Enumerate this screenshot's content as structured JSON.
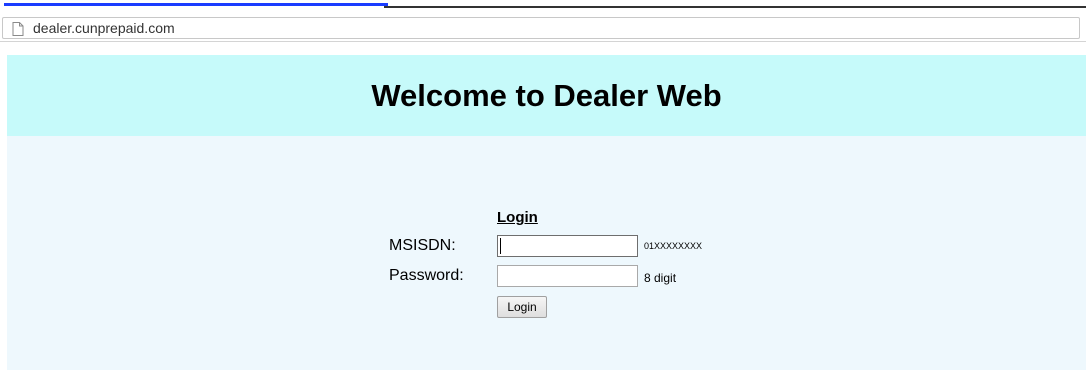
{
  "browser": {
    "url": "dealer.cunprepaid.com",
    "page_icon": "page-icon"
  },
  "header": {
    "title": "Welcome to Dealer Web"
  },
  "login_form": {
    "heading": "Login",
    "msisdn_label": "MSISDN:",
    "msisdn_value": "",
    "msisdn_hint": "01XXXXXXXX",
    "password_label": "Password:",
    "password_value": "",
    "password_hint": "8 digit",
    "submit_label": "Login"
  },
  "colors": {
    "header_band": "#c6fafa",
    "page_background": "#eef8fd",
    "top_link": "#1a3cff"
  }
}
